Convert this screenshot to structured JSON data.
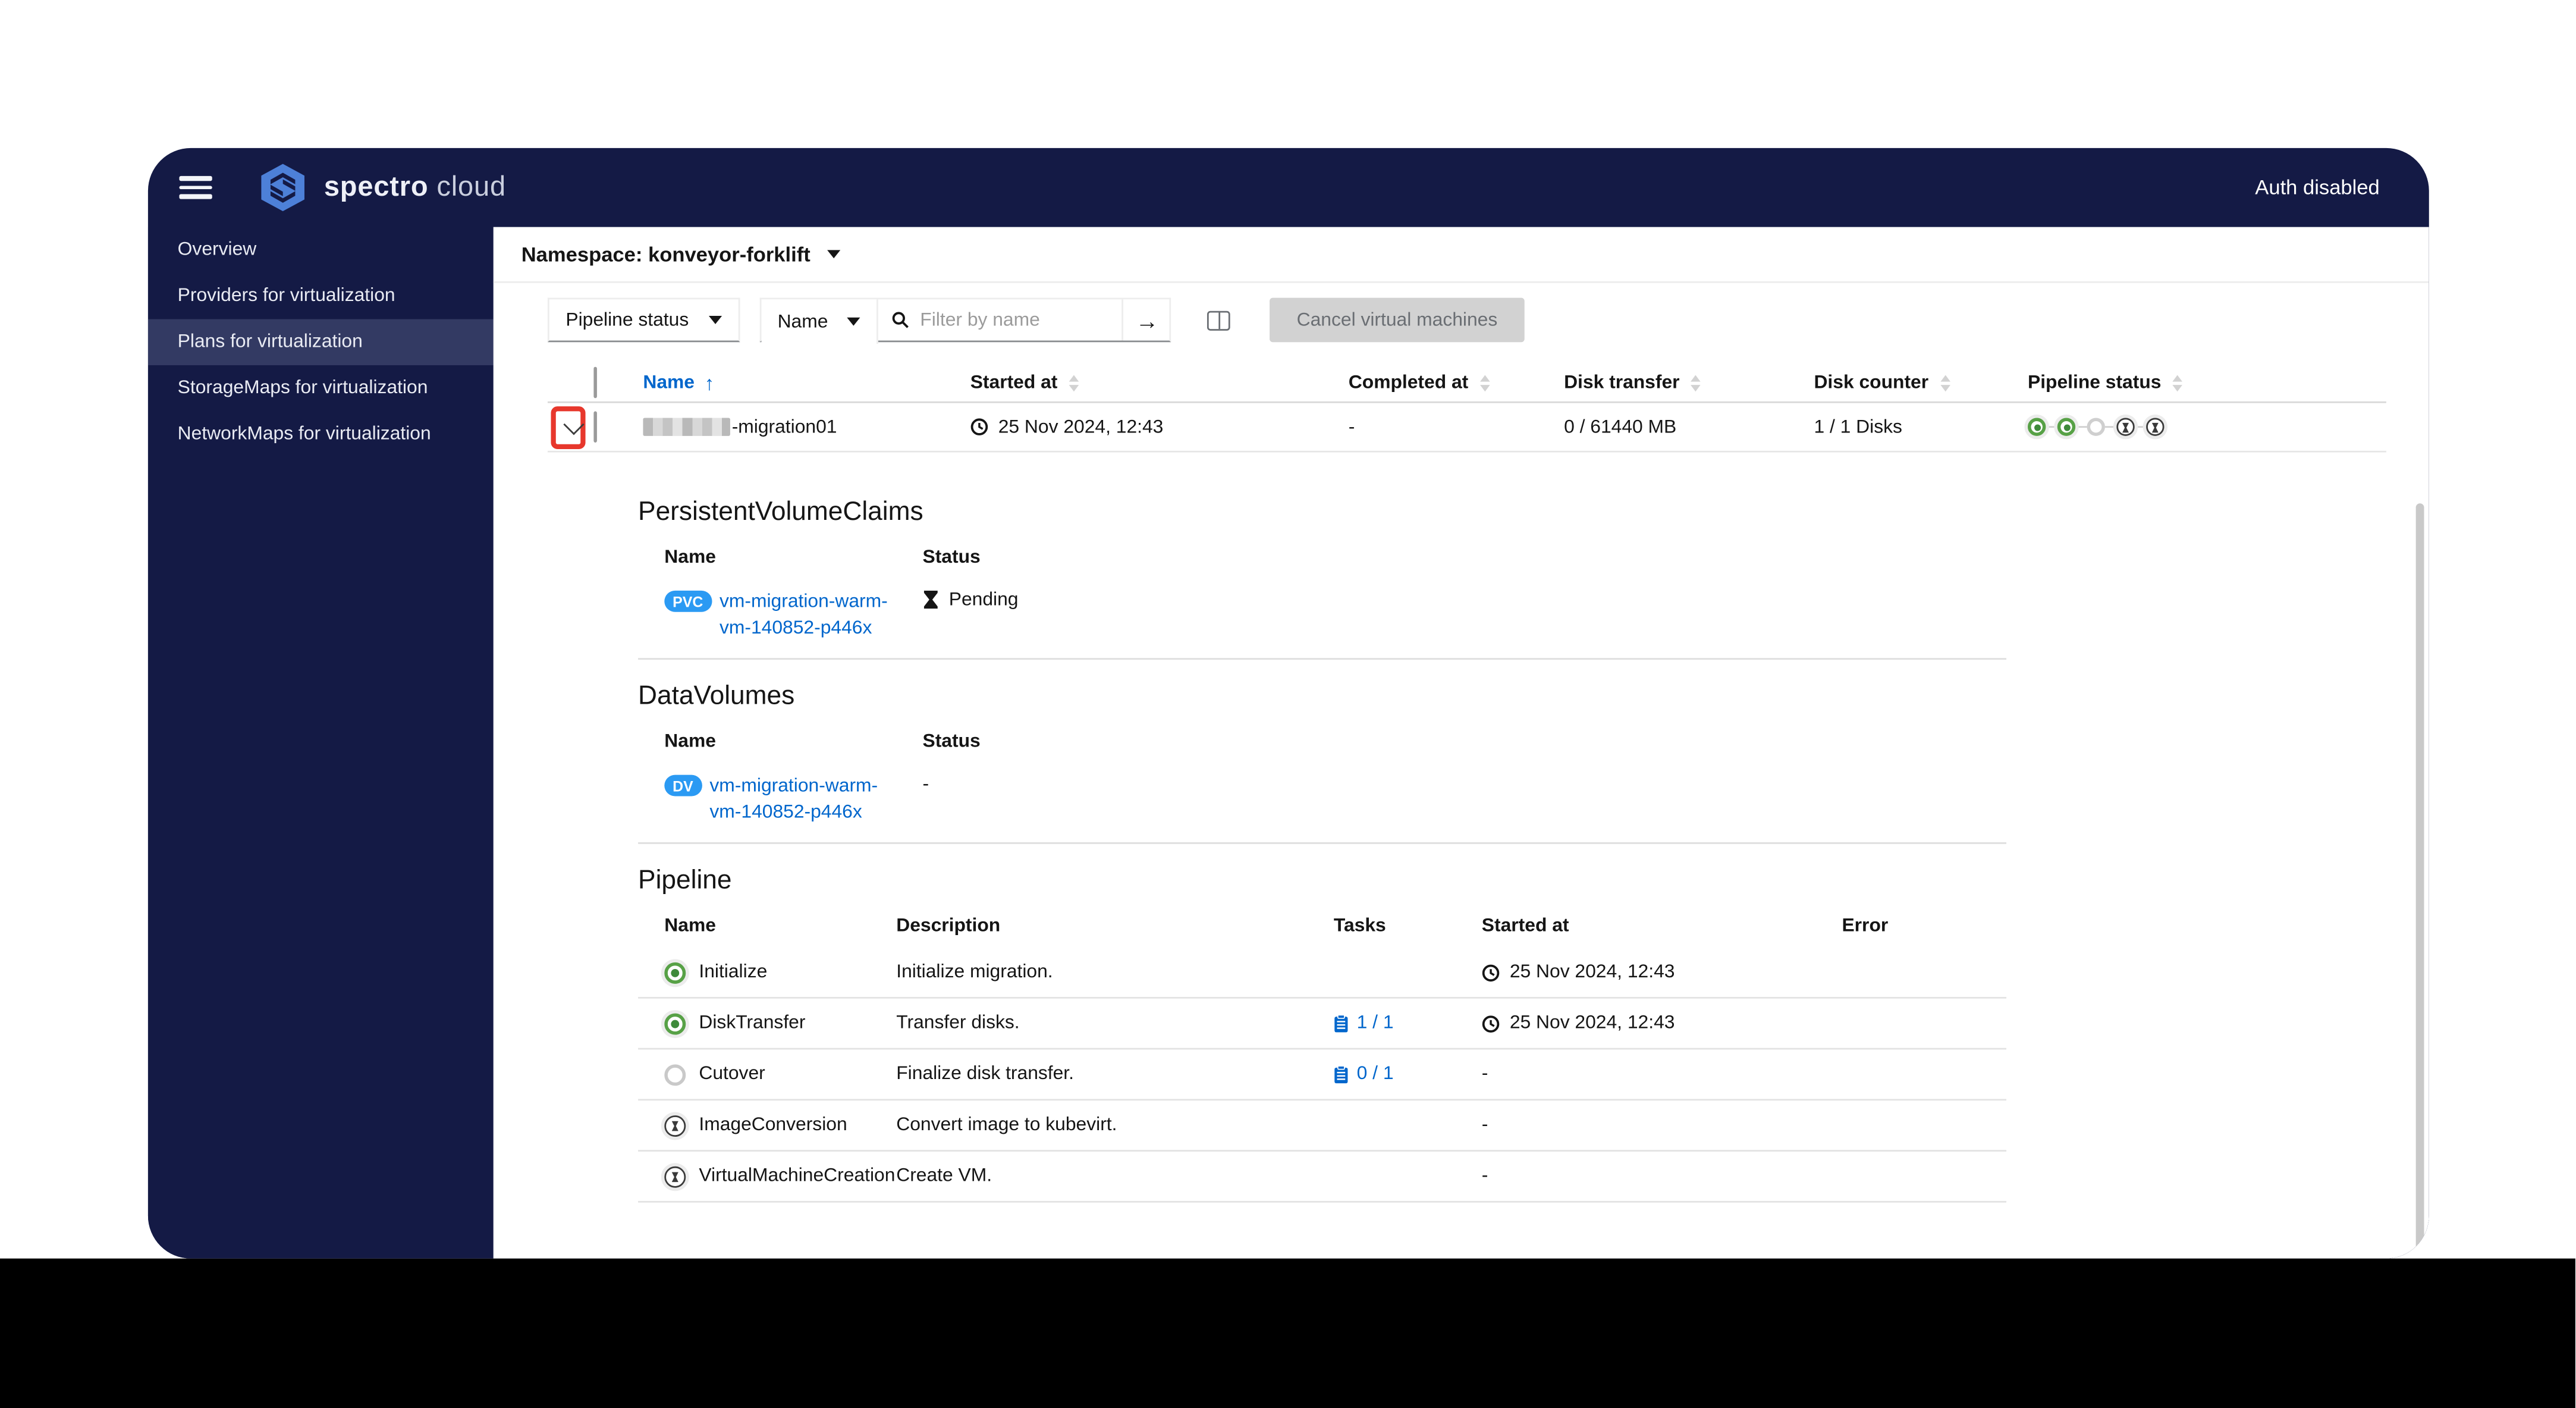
{
  "header": {
    "brand_primary": "spectro",
    "brand_secondary": "cloud",
    "auth_status": "Auth disabled"
  },
  "sidebar": {
    "items": [
      {
        "label": "Overview",
        "active": false
      },
      {
        "label": "Providers for virtualization",
        "active": false
      },
      {
        "label": "Plans for virtualization",
        "active": true
      },
      {
        "label": "StorageMaps for virtualization",
        "active": false
      },
      {
        "label": "NetworkMaps for virtualization",
        "active": false
      }
    ]
  },
  "content": {
    "namespace_label": "Namespace: konveyor-forklift",
    "toolbar": {
      "pipeline_status_filter": "Pipeline status",
      "attribute_filter": "Name",
      "search_placeholder": "Filter by name",
      "go_arrow": "→",
      "cancel_button": "Cancel virtual machines"
    },
    "table": {
      "columns": [
        "Name",
        "Started at",
        "Completed at",
        "Disk transfer",
        "Disk counter",
        "Pipeline status"
      ],
      "sort_arrow": "↑",
      "row": {
        "name_suffix": "-migration01",
        "started_at": "25 Nov 2024, 12:43",
        "completed_at": "-",
        "disk_transfer": "0 / 61440 MB",
        "disk_counter": "1 / 1 Disks",
        "pipeline_steps": [
          "done",
          "done",
          "current",
          "pending",
          "pending"
        ]
      }
    },
    "pvc_section": {
      "title": "PersistentVolumeClaims",
      "col_name": "Name",
      "col_status": "Status",
      "badge": "PVC",
      "link": "vm-migration-warm-vm-140852-p446x",
      "status": "Pending"
    },
    "dv_section": {
      "title": "DataVolumes",
      "col_name": "Name",
      "col_status": "Status",
      "badge": "DV",
      "link": "vm-migration-warm-vm-140852-p446x",
      "status": "-"
    },
    "pipeline_section": {
      "title": "Pipeline",
      "columns": [
        "Name",
        "Description",
        "Tasks",
        "Started at",
        "Error"
      ],
      "rows": [
        {
          "name": "Initialize",
          "description": "Initialize migration.",
          "tasks": "",
          "started_at": "25 Nov 2024, 12:43",
          "error": ""
        },
        {
          "name": "DiskTransfer",
          "description": "Transfer disks.",
          "tasks": "1 / 1",
          "started_at": "25 Nov 2024, 12:43",
          "error": ""
        },
        {
          "name": "Cutover",
          "description": "Finalize disk transfer.",
          "tasks": "0 / 1",
          "started_at": "-",
          "error": ""
        },
        {
          "name": "ImageConversion",
          "description": "Convert image to kubevirt.",
          "tasks": "",
          "started_at": "-",
          "error": ""
        },
        {
          "name": "VirtualMachineCreation",
          "description": "Create VM.",
          "tasks": "",
          "started_at": "-",
          "error": ""
        }
      ]
    }
  },
  "colors": {
    "navy": "#141a45",
    "active_item": "#333a63",
    "link_blue": "#0066cc",
    "badge_blue": "#2b9af3",
    "step_green": "#57a146",
    "annotation_red": "#e7372c",
    "disabled_gray": "#d2d2d2"
  }
}
